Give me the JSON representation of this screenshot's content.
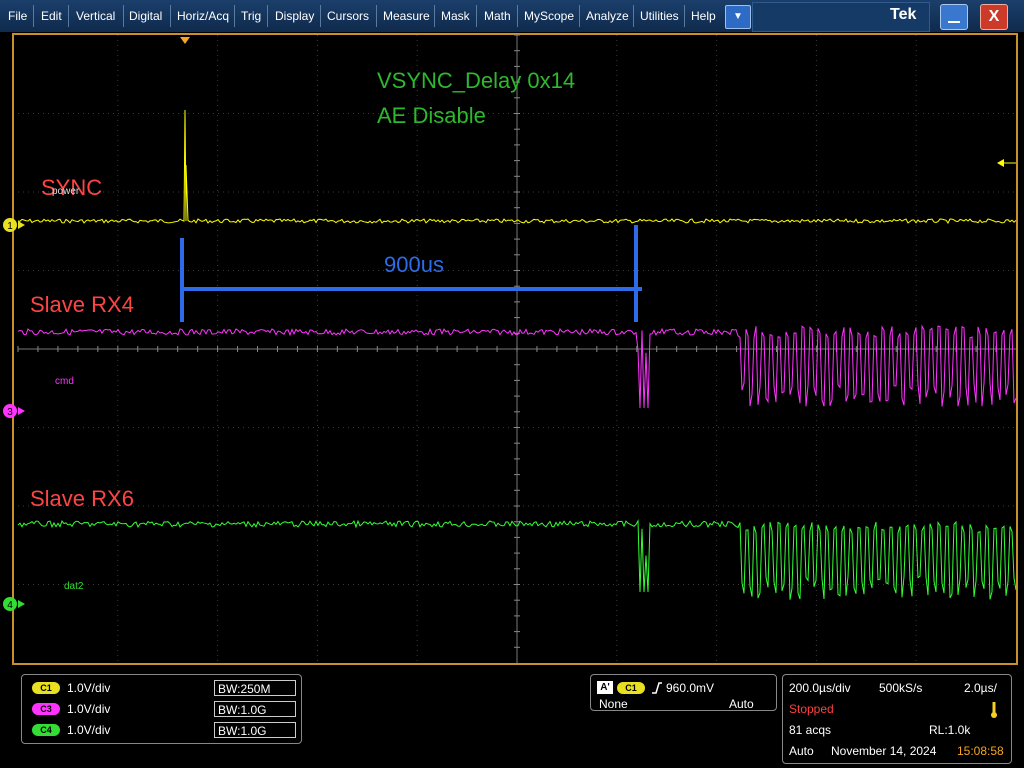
{
  "menu": {
    "items": [
      "File",
      "Edit",
      "Vertical",
      "Digital",
      "Horiz/Acq",
      "Trig",
      "Display",
      "Cursors",
      "Measure",
      "Mask",
      "Math",
      "MyScope",
      "Analyze",
      "Utilities",
      "Help"
    ],
    "dropdown_icon": "chevron-down-icon",
    "logo": "Tek",
    "minimize_icon": "minimize-icon",
    "close_label": "X"
  },
  "annotations": {
    "title_line1": "VSYNC_Delay 0x14",
    "title_line2": "AE Disable",
    "sync_label": "SYNC",
    "rx4_label": "Slave RX4",
    "rx6_label": "Slave RX6",
    "span_label": "900us"
  },
  "channel_tags": {
    "power": "power",
    "cmd": "cmd",
    "dat2": "dat2"
  },
  "markers": {
    "ch1": "1",
    "ch3": "3",
    "ch4": "4"
  },
  "colors": {
    "ch1": "#ffff00",
    "ch3": "#ff33ff",
    "ch4": "#33ff33",
    "annotation_green": "#2eb82e",
    "annotation_red": "#ff4444",
    "annotation_blue": "#2d6be8"
  },
  "channels": [
    {
      "badge": "C1",
      "scale": "1.0V/div",
      "bw": "250M",
      "color": "#e8e020"
    },
    {
      "badge": "C3",
      "scale": "1.0V/div",
      "bw": "1.0G",
      "color": "#ff33ff"
    },
    {
      "badge": "C4",
      "scale": "1.0V/div",
      "bw": "1.0G",
      "color": "#33dd33"
    }
  ],
  "bw_prefix": "BW:",
  "trigger": {
    "badge_a": "A'",
    "badge_ch": "C1",
    "level": "960.0mV",
    "coupling": "None",
    "mode": "Auto"
  },
  "acquisition": {
    "timebase": "200.0µs/div",
    "sample_rate": "500kS/s",
    "resolution": "2.0µs/",
    "state": "Stopped",
    "acqs": "81 acqs",
    "record_length": "RL:1.0k",
    "trigger_mode": "Auto",
    "date": "November 14, 2024",
    "time": "15:08:58"
  }
}
